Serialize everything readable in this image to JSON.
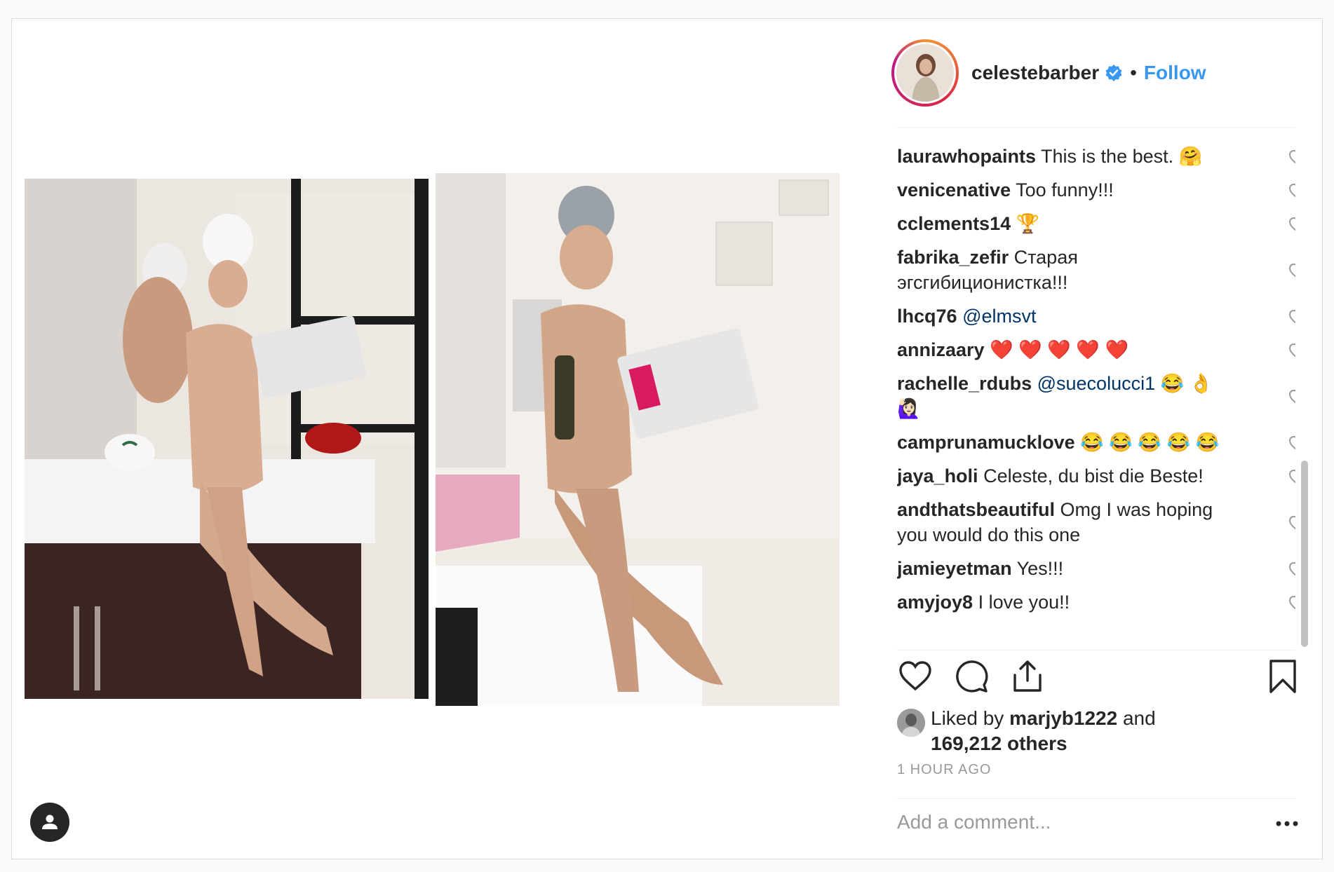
{
  "post": {
    "username": "celestebarber",
    "follow_label": "Follow",
    "dot": "•",
    "comments": [
      {
        "author": "laurawhopaints",
        "text": "This is the best. 🤗",
        "mention": ""
      },
      {
        "author": "venicenative",
        "text": "Too funny!!!",
        "mention": ""
      },
      {
        "author": "cclements14",
        "text": "🏆",
        "mention": ""
      },
      {
        "author": "fabrika_zefir",
        "text": "Старая",
        "text2": "эгсгибиционистка!!!",
        "mention": ""
      },
      {
        "author": "lhcq76",
        "text": "",
        "mention": "@elmsvt"
      },
      {
        "author": "annizaary",
        "text": "❤️ ❤️ ❤️ ❤️ ❤️",
        "mention": ""
      },
      {
        "author": "rachelle_rdubs",
        "text": "😂 👌",
        "text2": "🙋🏻‍♀️",
        "mention": "@suecolucci1"
      },
      {
        "author": "camprunamucklove",
        "text": "😂 😂 😂 😂 😂",
        "mention": ""
      },
      {
        "author": "jaya_holi",
        "text": "Celeste, du bist die Beste!",
        "mention": ""
      },
      {
        "author": "andthatsbeautiful",
        "text": "Omg I was hoping",
        "text2": "you would do this one",
        "mention": ""
      },
      {
        "author": "jamieyetman",
        "text": "Yes!!!",
        "mention": ""
      },
      {
        "author": "amyjoy8",
        "text": "I love you!!",
        "mention": ""
      }
    ],
    "likes": {
      "prefix": "Liked by",
      "liker": "marjyb1222",
      "and": "and",
      "others": "169,212 others"
    },
    "time_ago": "1 HOUR AGO",
    "add_comment_placeholder": "Add a comment...",
    "more_label": "•••"
  },
  "colors": {
    "link_blue": "#3897f0",
    "mention_blue": "#003569",
    "text": "#262626",
    "muted": "#999999"
  },
  "icons": [
    "user-tag-icon",
    "verified-icon",
    "heart-icon",
    "comment-icon",
    "share-icon",
    "bookmark-icon",
    "more-icon"
  ]
}
